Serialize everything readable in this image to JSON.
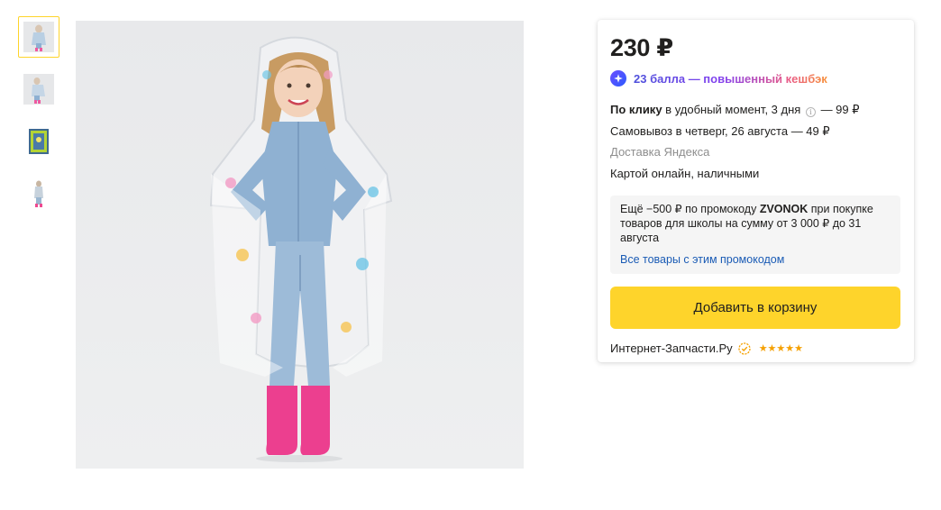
{
  "gallery": {
    "thumbnails": [
      {
        "name": "photo-1",
        "active": true
      },
      {
        "name": "photo-2",
        "active": false
      },
      {
        "name": "photo-3",
        "active": false
      },
      {
        "name": "photo-4",
        "active": false
      }
    ],
    "main_image_subject": "child-in-transparent-raincoat"
  },
  "offer": {
    "price": "230 ₽",
    "cashback": "23 балла — повышенный кешбэк",
    "delivery": {
      "click_bold": "По клику",
      "click_rest": " в удобный момент, 3 дня",
      "click_price": " — 99 ₽",
      "pickup": "Самовывоз в четверг, 26 августа — 49 ₽",
      "service": "Доставка Яндекса",
      "payment": "Картой онлайн, наличными"
    },
    "promo": {
      "prefix": "Ещё −500 ₽ по промокоду ",
      "code": "ZVONOK",
      "suffix": " при покупке товаров для школы на сумму от 3 000 ₽ до 31 августа",
      "link": "Все товары с этим промокодом"
    },
    "cart_button": "Добавить в корзину",
    "seller": {
      "name": "Интернет-Запчасти.Ру",
      "stars": "★★★★★"
    }
  },
  "colors": {
    "accent": "#fed42b",
    "link": "#1a5bb5",
    "stars": "#f5a000",
    "thumb_active_border": "#fed42b"
  }
}
